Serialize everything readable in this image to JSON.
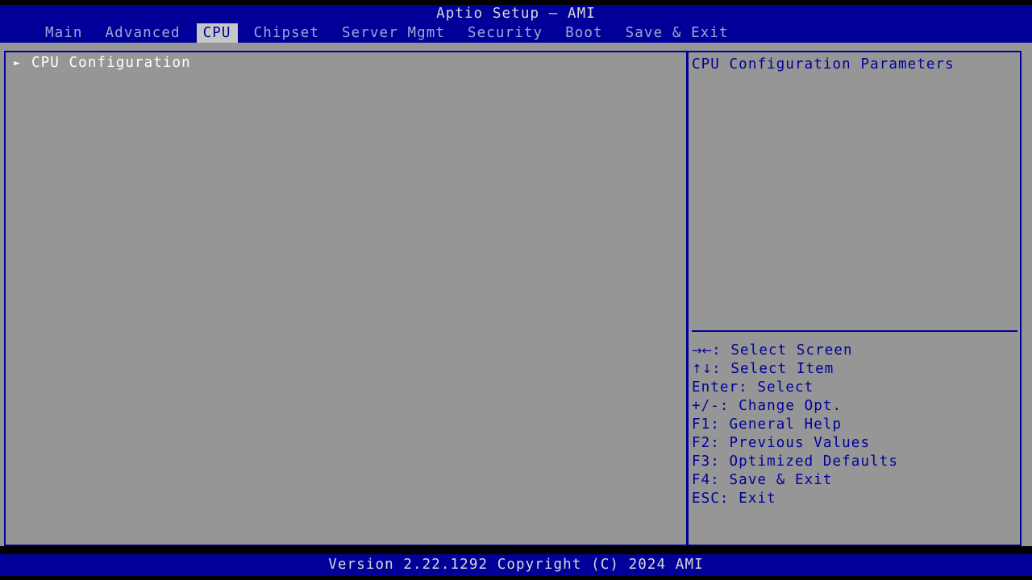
{
  "window": {
    "title": "Aptio Setup – AMI"
  },
  "colors": {
    "header_blue": "#000099",
    "screen_gray": "#969696",
    "active_tab_bg": "#c6c6c6",
    "menu_text": "#9fa7d4",
    "selected_text": "#ffffff",
    "help_text": "#000099",
    "title_text": "#d8d8d8"
  },
  "menu": {
    "items": [
      {
        "label": "Main",
        "active": false
      },
      {
        "label": "Advanced",
        "active": false
      },
      {
        "label": "CPU",
        "active": true
      },
      {
        "label": "Chipset",
        "active": false
      },
      {
        "label": "Server Mgmt",
        "active": false
      },
      {
        "label": "Security",
        "active": false
      },
      {
        "label": "Boot",
        "active": false
      },
      {
        "label": "Save & Exit",
        "active": false
      }
    ]
  },
  "settings": {
    "rows": [
      {
        "marker": "►",
        "marker_icon": "submenu-triangle-icon",
        "label": "CPU Configuration",
        "selected": true
      }
    ]
  },
  "help": {
    "description": "CPU Configuration Parameters",
    "keys": [
      {
        "glyph": "→←",
        "text": ": Select Screen"
      },
      {
        "glyph": "↑↓",
        "text": ": Select Item"
      },
      {
        "glyph": "",
        "text": "Enter: Select"
      },
      {
        "glyph": "",
        "text": "+/-: Change Opt."
      },
      {
        "glyph": "",
        "text": "F1: General Help"
      },
      {
        "glyph": "",
        "text": "F2: Previous Values"
      },
      {
        "glyph": "",
        "text": "F3: Optimized Defaults"
      },
      {
        "glyph": "",
        "text": "F4: Save & Exit"
      },
      {
        "glyph": "",
        "text": "ESC: Exit"
      }
    ]
  },
  "footer": {
    "version_text": "Version 2.22.1292 Copyright (C) 2024 AMI"
  }
}
